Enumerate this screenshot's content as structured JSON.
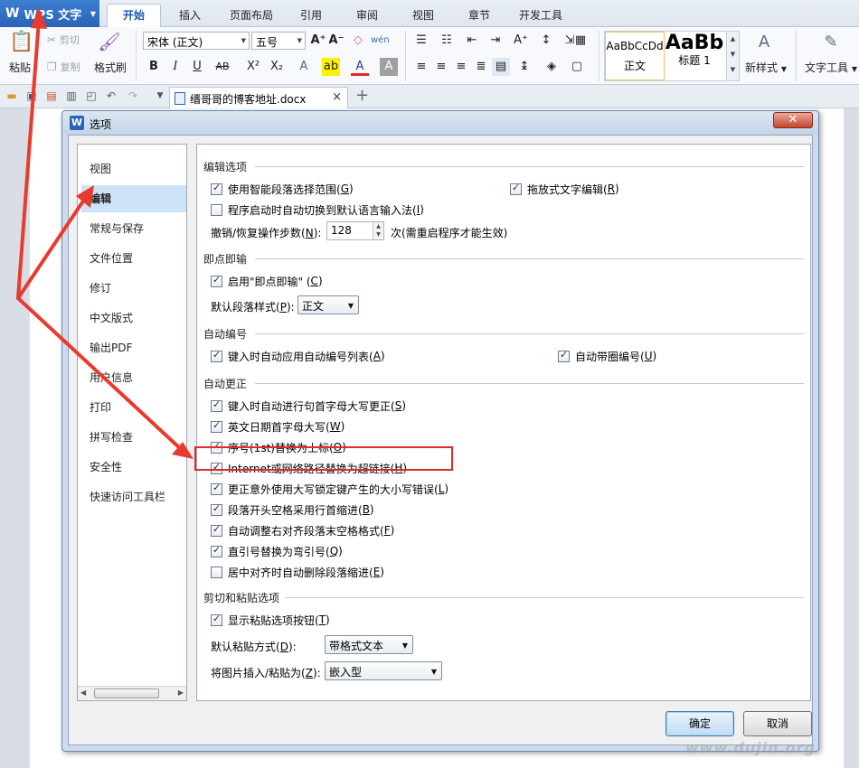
{
  "app": {
    "title": "WPS 文字",
    "logo_letter": "W"
  },
  "ribbon": {
    "tabs": [
      "开始",
      "插入",
      "页面布局",
      "引用",
      "审阅",
      "视图",
      "章节",
      "开发工具"
    ],
    "active_tab": "开始",
    "clipboard": {
      "paste": "粘贴",
      "cut": "剪切",
      "copy": "复制",
      "format_painter": "格式刷"
    },
    "font_name": "宋体 (正文)",
    "font_size": "五号",
    "styles": {
      "normal_sample": "AaBbCcDd",
      "normal_label": "正文",
      "heading_sample": "AaBb",
      "heading_label": "标题 1",
      "new_style": "新样式",
      "text_tools": "文字工具"
    }
  },
  "document_tab": {
    "name": "缙哥哥的博客地址.docx",
    "close": "×",
    "new_tab": "+"
  },
  "dialog": {
    "title": "选项",
    "close": "✕",
    "nav": [
      "视图",
      "编辑",
      "常规与保存",
      "文件位置",
      "修订",
      "中文版式",
      "输出PDF",
      "用户信息",
      "打印",
      "拼写检查",
      "安全性",
      "快速访问工具栏"
    ],
    "nav_selected": "编辑",
    "groups": {
      "edit": {
        "title": "编辑选项",
        "smart_select": "使用智能段落选择范围(",
        "smart_select_key": "G",
        "drag_drop": "拖放式文字编辑(",
        "drag_drop_key": "R",
        "auto_ime": "程序启动时自动切换到默认语言输入法(",
        "auto_ime_key": "I",
        "undo_label": "撤销/恢复操作步数(",
        "undo_key": "N",
        "undo_value": "128",
        "undo_note": "次(需重启程序才能生效)"
      },
      "click_type": {
        "title": "即点即输",
        "enable": "启用\"即点即输\" (",
        "enable_key": "C",
        "default_style_label": "默认段落样式(",
        "default_style_key": "P",
        "default_style_value": "正文"
      },
      "auto_number": {
        "title": "自动编号",
        "auto_list": "键入时自动应用自动编号列表(",
        "auto_list_key": "A",
        "auto_circle": "自动带圈编号(",
        "auto_circle_key": "U"
      },
      "auto_correct": {
        "title": "自动更正",
        "items": [
          {
            "text": "键入时自动进行句首字母大写更正(",
            "key": "S",
            "checked": true
          },
          {
            "text": "英文日期首字母大写(",
            "key": "W",
            "checked": true
          },
          {
            "text": "序号(1st)替换为上标(",
            "key": "O",
            "checked": true
          },
          {
            "text": "Internet或网络路径替换为超链接(",
            "key": "H",
            "checked": true
          },
          {
            "text": "更正意外使用大写锁定键产生的大小写错误(",
            "key": "L",
            "checked": true
          },
          {
            "text": "段落开头空格采用行首缩进(",
            "key": "B",
            "checked": true
          },
          {
            "text": "自动调整右对齐段落末空格格式(",
            "key": "F",
            "checked": true
          },
          {
            "text": "直引号替换为弯引号(",
            "key": "Q",
            "checked": true
          },
          {
            "text": "居中对齐时自动删除段落缩进(",
            "key": "E",
            "checked": false
          }
        ]
      },
      "paste": {
        "title": "剪切和粘贴选项",
        "show_button": "显示粘贴选项按钮(",
        "show_button_key": "T",
        "default_paste_label": "默认粘贴方式(",
        "default_paste_key": "D",
        "default_paste_value": "带格式文本",
        "image_paste_label": "将图片插入/粘贴为(",
        "image_paste_key": "Z",
        "image_paste_value": "嵌入型"
      }
    },
    "ok": "确定",
    "cancel": "取消"
  },
  "close_paren": ")",
  "colon_suffix": "):",
  "watermark": "www.dujin.org",
  "colors": {
    "accent": "#2a64b6",
    "highlight_box": "#e02b2b",
    "annotation_arrow": "#e83a2f",
    "nav_selected_bg": "#cde3f7"
  }
}
